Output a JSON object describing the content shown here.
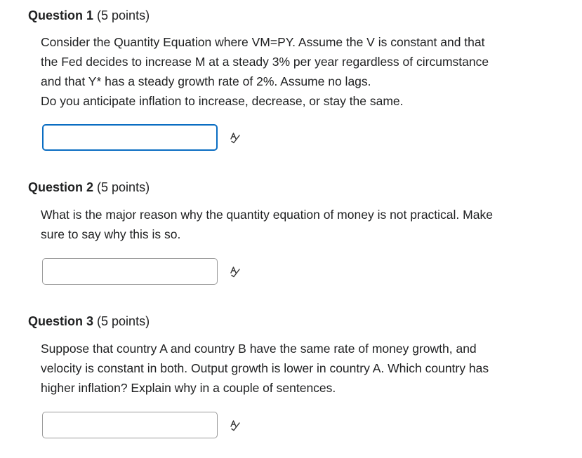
{
  "questions": [
    {
      "number_label": "Question 1",
      "points_label": "(5 points)",
      "body_lines": [
        "Consider the Quantity Equation where VM=PY. Assume the V is constant and that",
        "the Fed decides to increase M at a steady 3% per year regardless of circumstance",
        "and that Y* has a steady growth rate of 2%. Assume no lags.",
        "Do you anticipate inflation to increase, decrease, or stay the same."
      ],
      "answer_value": "",
      "answer_focused": true,
      "icon": "spell-check-icon"
    },
    {
      "number_label": "Question 2",
      "points_label": "(5 points)",
      "body_lines": [
        "What is the major reason why the quantity equation of money is not practical. Make",
        "sure to say why this is so."
      ],
      "answer_value": "",
      "answer_focused": false,
      "icon": "spell-check-icon"
    },
    {
      "number_label": "Question 3",
      "points_label": "(5 points)",
      "body_lines": [
        "Suppose that country A and country B have the same rate of money growth, and",
        "velocity is constant in both. Output growth is lower in country A. Which country has",
        "higher inflation? Explain why in a couple of sentences."
      ],
      "answer_value": "",
      "answer_focused": false,
      "icon": "spell-check-icon"
    }
  ],
  "colors": {
    "text": "#202122",
    "focus_border": "#0a6dc2",
    "input_border": "#9a9a9a"
  }
}
